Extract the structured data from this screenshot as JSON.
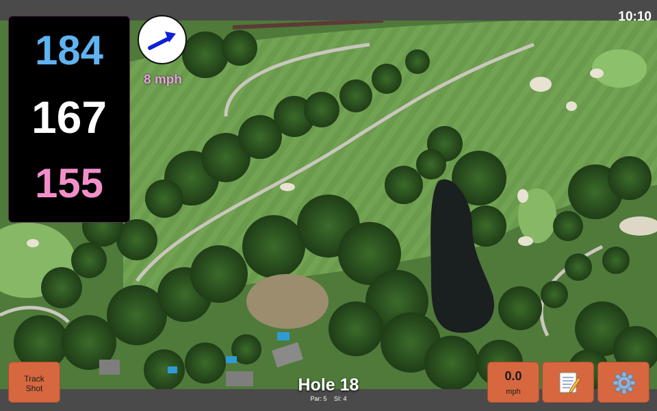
{
  "status": {
    "clock": "10:10"
  },
  "distances": {
    "back": "184",
    "middle": "167",
    "front": "155"
  },
  "wind": {
    "speed_label": "8 mph",
    "direction_icon": "wind-arrow-icon"
  },
  "buttons": {
    "track_shot_line1": "Track",
    "track_shot_line2": "Shot",
    "speed_value": "0.0",
    "speed_unit": "mph",
    "notes_icon": "notepad-icon",
    "settings_icon": "gear-icon"
  },
  "hole": {
    "title": "Hole 18",
    "par": "Par: 5",
    "si": "SI: 4"
  },
  "colors": {
    "back": "#5fb3f0",
    "middle": "#ffffff",
    "front": "#f28fc9",
    "button": "#d6673f",
    "wind_label": "#e8a4e0"
  }
}
